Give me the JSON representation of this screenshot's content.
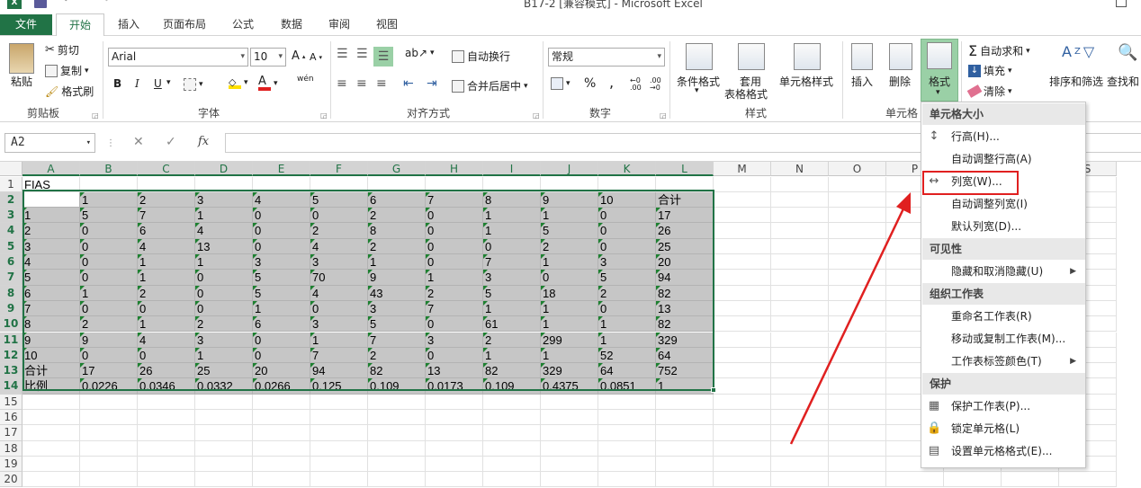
{
  "window": {
    "title": "B17-2  [兼容模式] - Microsoft Excel"
  },
  "tabs": [
    "文件",
    "开始",
    "插入",
    "页面布局",
    "公式",
    "数据",
    "审阅",
    "视图"
  ],
  "ribbon": {
    "clipboard": {
      "paste": "粘贴",
      "cut": "剪切",
      "copy": "复制",
      "format_painter": "格式刷",
      "label": "剪贴板"
    },
    "font": {
      "name": "Arial",
      "size": "10",
      "bold": "B",
      "italic": "I",
      "underline": "U",
      "wen": "wén",
      "label": "字体"
    },
    "alignment": {
      "wrap": "自动换行",
      "merge": "合并后居中",
      "label": "对齐方式"
    },
    "number": {
      "format": "常规",
      "percent": "%",
      "comma": ",",
      "label": "数字"
    },
    "styles": {
      "conditional": "条件格式",
      "table_1": "套用",
      "table_2": "表格格式",
      "cell_styles": "单元格样式",
      "label": "样式"
    },
    "cells": {
      "insert": "插入",
      "delete": "删除",
      "format": "格式",
      "label": "单元格"
    },
    "editing": {
      "autosum": "自动求和",
      "fill": "填充",
      "clear": "清除",
      "sort": "排序和筛选",
      "find": "查找和"
    }
  },
  "formula_bar": {
    "name_box": "A2",
    "fx": "fx",
    "cancel": "✕",
    "enter": "✓"
  },
  "grid": {
    "columns": [
      "A",
      "B",
      "C",
      "D",
      "E",
      "F",
      "G",
      "H",
      "I",
      "J",
      "K",
      "L",
      "M",
      "N",
      "O",
      "P",
      "Q",
      "R",
      "S"
    ],
    "rows": [
      "1",
      "2",
      "3",
      "4",
      "5",
      "6",
      "7",
      "8",
      "9",
      "10",
      "11",
      "12",
      "13",
      "14",
      "15",
      "16",
      "17",
      "18",
      "19",
      "20"
    ],
    "cells": [
      [
        "FIAS",
        "",
        "",
        "",
        "",
        "",
        "",
        "",
        "",
        "",
        "",
        ""
      ],
      [
        "",
        "1",
        "2",
        "3",
        "4",
        "5",
        "6",
        "7",
        "8",
        "9",
        "10",
        "合计"
      ],
      [
        "1",
        "5",
        "7",
        "1",
        "0",
        "0",
        "2",
        "0",
        "1",
        "1",
        "0",
        "17"
      ],
      [
        "2",
        "0",
        "6",
        "4",
        "0",
        "2",
        "8",
        "0",
        "1",
        "5",
        "0",
        "26"
      ],
      [
        "3",
        "0",
        "4",
        "13",
        "0",
        "4",
        "2",
        "0",
        "0",
        "2",
        "0",
        "25"
      ],
      [
        "4",
        "0",
        "1",
        "1",
        "3",
        "3",
        "1",
        "0",
        "7",
        "1",
        "3",
        "20"
      ],
      [
        "5",
        "0",
        "1",
        "0",
        "5",
        "70",
        "9",
        "1",
        "3",
        "0",
        "5",
        "94"
      ],
      [
        "6",
        "1",
        "2",
        "0",
        "5",
        "4",
        "43",
        "2",
        "5",
        "18",
        "2",
        "82"
      ],
      [
        "7",
        "0",
        "0",
        "0",
        "1",
        "0",
        "3",
        "7",
        "1",
        "1",
        "0",
        "13"
      ],
      [
        "8",
        "2",
        "1",
        "2",
        "6",
        "3",
        "5",
        "0",
        "61",
        "1",
        "1",
        "82"
      ],
      [
        "9",
        "9",
        "4",
        "3",
        "0",
        "1",
        "7",
        "3",
        "2",
        "299",
        "1",
        "329"
      ],
      [
        "10",
        "0",
        "0",
        "1",
        "0",
        "7",
        "2",
        "0",
        "1",
        "1",
        "52",
        "64"
      ],
      [
        "合计",
        "17",
        "26",
        "25",
        "20",
        "94",
        "82",
        "13",
        "82",
        "329",
        "64",
        "752"
      ],
      [
        "比例",
        "0.0226",
        "0.0346",
        "0.0332",
        "0.0266",
        "0.125",
        "0.109",
        "0.0173",
        "0.109",
        "0.4375",
        "0.0851",
        "1"
      ]
    ]
  },
  "format_menu": {
    "sections": [
      {
        "header": "单元格大小",
        "items": [
          {
            "label": "行高(H)...",
            "icon": "row-height-icon"
          },
          {
            "label": "自动调整行高(A)",
            "icon": ""
          },
          {
            "label": "列宽(W)...",
            "icon": "column-width-icon"
          },
          {
            "label": "自动调整列宽(I)",
            "icon": ""
          },
          {
            "label": "默认列宽(D)...",
            "icon": ""
          }
        ]
      },
      {
        "header": "可见性",
        "items": [
          {
            "label": "隐藏和取消隐藏(U)",
            "icon": "",
            "submenu": true
          }
        ]
      },
      {
        "header": "组织工作表",
        "items": [
          {
            "label": "重命名工作表(R)",
            "icon": ""
          },
          {
            "label": "移动或复制工作表(M)...",
            "icon": ""
          },
          {
            "label": "工作表标签颜色(T)",
            "icon": "",
            "submenu": true
          }
        ]
      },
      {
        "header": "保护",
        "items": [
          {
            "label": "保护工作表(P)...",
            "icon": "protect-sheet-icon"
          },
          {
            "label": "锁定单元格(L)",
            "icon": "lock-icon"
          },
          {
            "label": "设置单元格格式(E)...",
            "icon": "format-cells-icon"
          }
        ]
      }
    ]
  },
  "colors": {
    "accent": "#217346",
    "highlight": "#e02020"
  }
}
